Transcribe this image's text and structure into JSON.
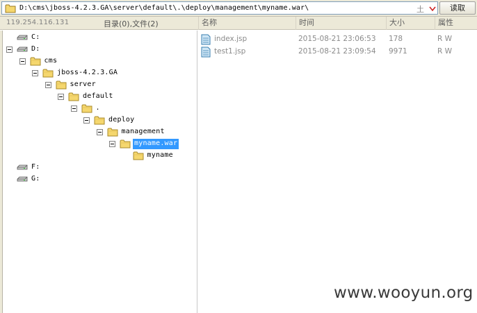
{
  "address": {
    "path": "D:\\cms\\jboss-4.2.3.GA\\server\\default\\.\\deploy\\management\\myname.war\\",
    "plus_glyph": "土",
    "read_label": "读取"
  },
  "status": {
    "ip": "119.254.116.131",
    "counts": "目录(0),文件(2)"
  },
  "columns": [
    "名称",
    "时间",
    "大小",
    "属性"
  ],
  "tree": [
    {
      "label": "C:",
      "type": "drive",
      "expanded": null
    },
    {
      "label": "D:",
      "type": "drive",
      "expanded": true
    },
    {
      "label": "cms",
      "type": "folder",
      "expanded": true
    },
    {
      "label": "jboss-4.2.3.GA",
      "type": "folder",
      "expanded": true
    },
    {
      "label": "server",
      "type": "folder",
      "expanded": true
    },
    {
      "label": "default",
      "type": "folder",
      "expanded": true
    },
    {
      "label": ".",
      "type": "folder",
      "expanded": true
    },
    {
      "label": "deploy",
      "type": "folder",
      "expanded": true
    },
    {
      "label": "management",
      "type": "folder",
      "expanded": true
    },
    {
      "label": "myname.war",
      "type": "folder",
      "expanded": true,
      "selected": true
    },
    {
      "label": "myname",
      "type": "folder",
      "expanded": null
    },
    {
      "label": "F:",
      "type": "drive",
      "expanded": null
    },
    {
      "label": "G:",
      "type": "drive",
      "expanded": null
    }
  ],
  "files": [
    {
      "name": "index.jsp",
      "time": "2015-08-21 23:06:53",
      "size": "178",
      "attr": "R W"
    },
    {
      "name": "test1.jsp",
      "time": "2015-08-21 23:09:54",
      "size": "9971",
      "attr": "R W"
    }
  ],
  "watermark": "www.wooyun.org",
  "colors": {
    "selection": "#3399ff",
    "folder": "#f5d76e",
    "chrome": "#ece9d8",
    "dropdown_arrow": "#cc2222"
  },
  "icons": {
    "drive": "drive-icon",
    "folder": "folder-icon",
    "file": "jsp-file-icon",
    "expander": "collapse-box-icon",
    "dropdown": "chevron-down-icon"
  }
}
